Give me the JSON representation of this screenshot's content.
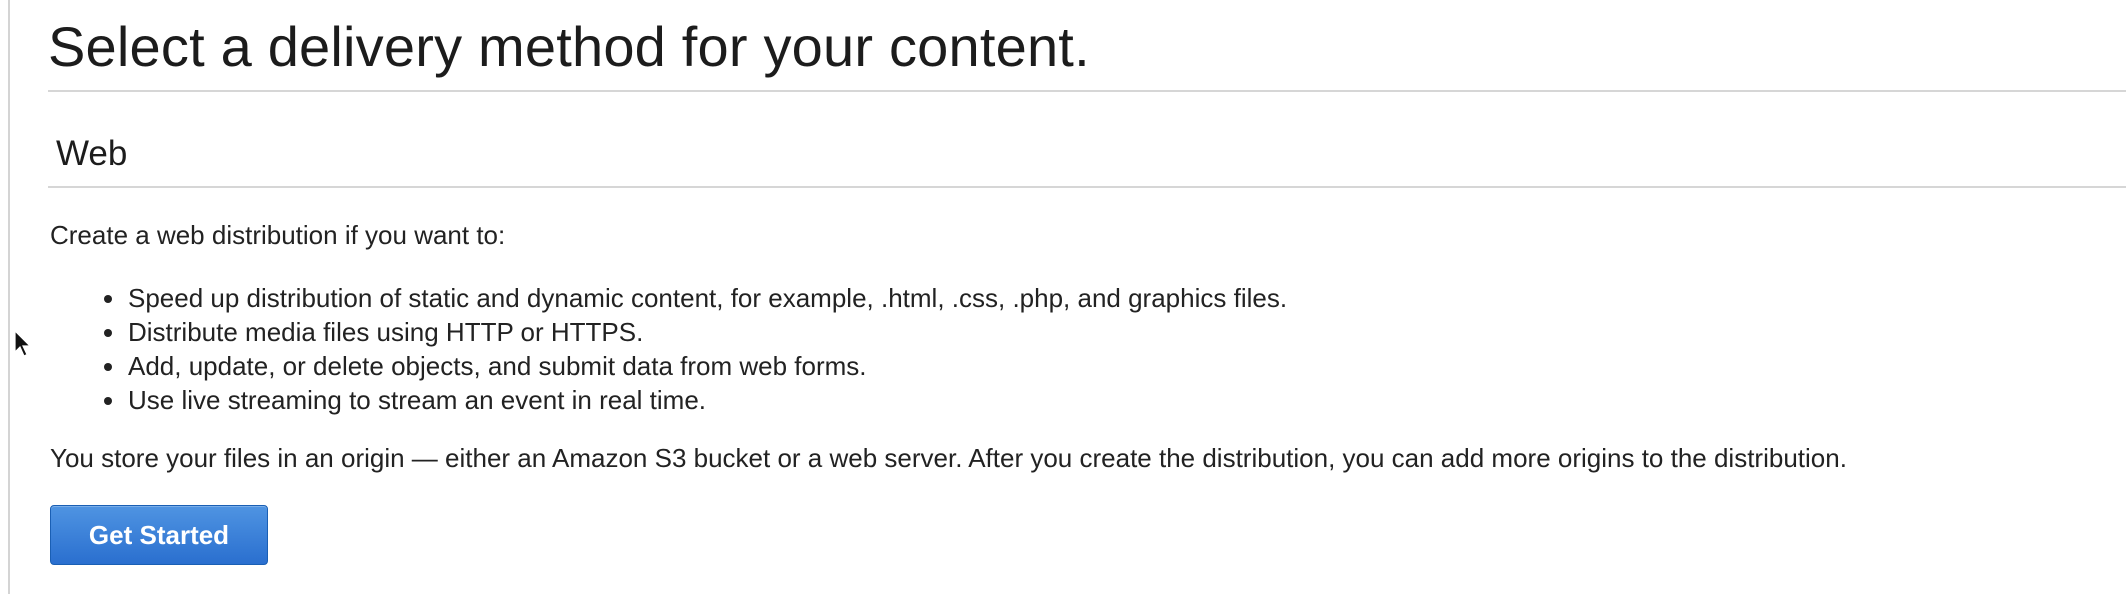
{
  "page": {
    "title": "Select a delivery method for your content."
  },
  "section": {
    "heading": "Web",
    "intro": "Create a web distribution if you want to:",
    "bullets": [
      "Speed up distribution of static and dynamic content, for example, .html, .css, .php, and graphics files.",
      "Distribute media files using HTTP or HTTPS.",
      "Add, update, or delete objects, and submit data from web forms.",
      "Use live streaming to stream an event in real time."
    ],
    "origin_note": "You store your files in an origin — either an Amazon S3 bucket or a web server. After you create the distribution, you can add more origins to the distribution."
  },
  "actions": {
    "get_started_label": "Get Started"
  },
  "icons": {
    "cursor": "mouse-pointer-icon"
  },
  "colors": {
    "button_primary": "#2a6fcf",
    "text": "#222222",
    "rule": "#d6d6d6"
  }
}
